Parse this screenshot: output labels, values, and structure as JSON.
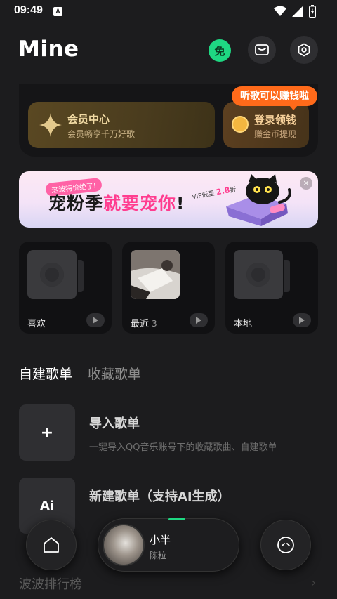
{
  "status": {
    "time": "09:49",
    "notif_letter": "A"
  },
  "header": {
    "title": "Mine",
    "free_label": "免"
  },
  "vip": {
    "title": "会员中心",
    "subtitle": "会员畅享千万好歌"
  },
  "coin": {
    "title": "登录领钱",
    "subtitle": "赚金币提现",
    "tip": "听歌可以赚钱啦"
  },
  "banner": {
    "tag": "这波特价绝了!",
    "headline_a": "宠粉季",
    "headline_b": "就要宠你",
    "headline_c": "!",
    "vip_text": "VIP低至",
    "vip_price": "2.8",
    "vip_unit": "折",
    "close": "×"
  },
  "tiles": [
    {
      "label": "喜欢",
      "count": ""
    },
    {
      "label": "最近",
      "count": "3"
    },
    {
      "label": "本地",
      "count": ""
    }
  ],
  "tabs": [
    {
      "label": "自建歌单",
      "active": true
    },
    {
      "label": "收藏歌单",
      "active": false
    }
  ],
  "playlists": [
    {
      "icon": "+",
      "title": "导入歌单",
      "desc": "一键导入QQ音乐账号下的收藏歌曲、自建歌单"
    },
    {
      "icon": "Ai",
      "title": "新建歌单（支持AI生成）",
      "desc": ""
    }
  ],
  "charts": {
    "title": "波波排行榜"
  },
  "player": {
    "song": "小半",
    "artist": "陈粒"
  },
  "colors": {
    "accent": "#1ed882",
    "tip": "#ff6a1a",
    "banner_pink": "#ff3d8f"
  }
}
